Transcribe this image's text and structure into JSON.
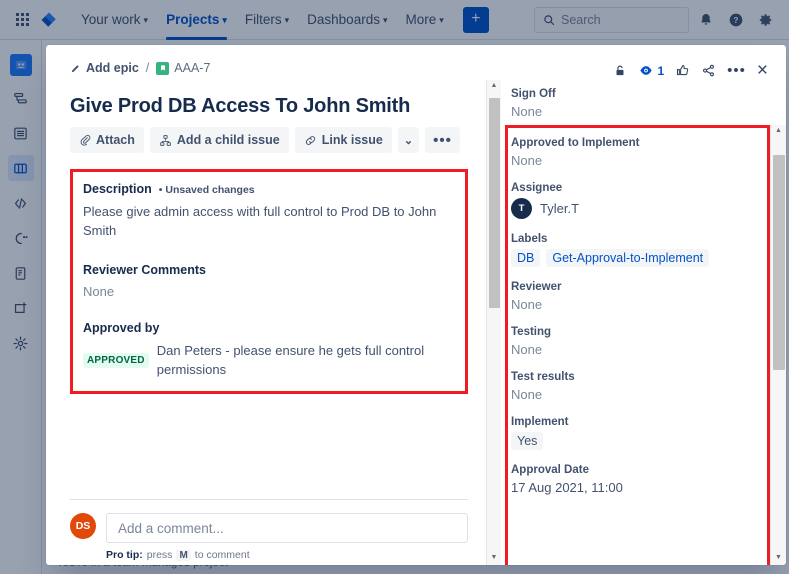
{
  "topnav": {
    "apps_icon": "app-switcher-icon",
    "logo": "jira-logo-icon",
    "items": [
      {
        "label": "Your work",
        "has_caret": true,
        "active": false
      },
      {
        "label": "Projects",
        "has_caret": true,
        "active": true
      },
      {
        "label": "Filters",
        "has_caret": true,
        "active": false
      },
      {
        "label": "Dashboards",
        "has_caret": true,
        "active": false
      },
      {
        "label": "More",
        "has_caret": true,
        "active": false
      }
    ],
    "create_label": "+",
    "search_placeholder": "Search",
    "icons": [
      "notifications-bell-icon",
      "help-icon",
      "settings-gear-icon"
    ],
    "accent": "#0052cc"
  },
  "sidebar": {
    "items": [
      {
        "name": "project-avatar",
        "icon": "project-avatar-icon",
        "active": false
      },
      {
        "name": "roadmap",
        "icon": "roadmap-icon",
        "active": false
      },
      {
        "name": "backlog",
        "icon": "backlog-icon",
        "active": false
      },
      {
        "name": "board",
        "icon": "board-icon",
        "active": true
      },
      {
        "name": "code",
        "icon": "code-icon",
        "active": false
      },
      {
        "name": "releases",
        "icon": "releases-icon",
        "active": false
      },
      {
        "name": "pages",
        "icon": "pages-icon",
        "active": false
      },
      {
        "name": "add-item",
        "icon": "add-shortcut-icon",
        "active": false
      },
      {
        "name": "project-settings",
        "icon": "settings-gear-icon",
        "active": false
      }
    ]
  },
  "statusbar": {
    "text": "You're in a team-managed project"
  },
  "modal": {
    "breadcrumb": {
      "add_epic": "Add epic",
      "separator": "/",
      "issue_key": "AAA-7",
      "issue_type_icon": "task-icon"
    },
    "header_actions": [
      {
        "name": "lock-icon",
        "label": ""
      },
      {
        "name": "watch-eye-icon",
        "label": "1"
      },
      {
        "name": "thumbs-up-icon",
        "label": ""
      },
      {
        "name": "share-icon",
        "label": ""
      },
      {
        "name": "more-actions-icon",
        "label": "•••"
      },
      {
        "name": "close-icon",
        "label": "×"
      }
    ],
    "title": "Give Prod DB Access To John Smith",
    "buttons": [
      {
        "name": "attach-button",
        "label": "Attach",
        "icon": "paperclip-icon"
      },
      {
        "name": "add-child-issue-button",
        "label": "Add a child issue",
        "icon": "child-issue-icon"
      },
      {
        "name": "link-issue-button",
        "label": "Link issue",
        "icon": "link-icon"
      },
      {
        "name": "more-options-chevron",
        "label": "⌄",
        "icon": "chevron-down-icon"
      },
      {
        "name": "more-actions-button",
        "label": "•••",
        "icon": "ellipsis-icon"
      }
    ],
    "description": {
      "label": "Description",
      "unsaved": "• Unsaved changes",
      "body": "Please give admin access with full control to Prod DB to John Smith"
    },
    "reviewer_comments": {
      "label": "Reviewer Comments",
      "value": "None"
    },
    "approved_by": {
      "label": "Approved by",
      "badge": "APPROVED",
      "text": "Dan Peters - please ensure he gets full control permissions",
      "badge_bg": "#e3fcef",
      "badge_color": "#006644"
    },
    "comment": {
      "avatar_initials": "DS",
      "placeholder": "Add a comment...",
      "protip_prefix": "Pro tip:",
      "protip_press": "press",
      "protip_key": "M",
      "protip_suffix": "to comment"
    },
    "fields": [
      {
        "label": "Sign Off",
        "value": "None",
        "type": "none"
      },
      {
        "label": "Approved to Implement",
        "value": "None",
        "type": "none"
      },
      {
        "label": "Assignee",
        "value": "Tyler.T",
        "type": "user",
        "avatar_initial": "T"
      },
      {
        "label": "Labels",
        "type": "labels",
        "values": [
          "DB",
          "Get-Approval-to-Implement"
        ]
      },
      {
        "label": "Reviewer",
        "value": "None",
        "type": "none"
      },
      {
        "label": "Testing",
        "value": "None",
        "type": "none"
      },
      {
        "label": "Test results",
        "value": "None",
        "type": "none"
      },
      {
        "label": "Implement",
        "value": "Yes",
        "type": "chip"
      },
      {
        "label": "Approval Date",
        "value": "17 Aug 2021, 11:00",
        "type": "text"
      }
    ]
  },
  "annotations": {
    "box_color": "#ee1c25",
    "description_box": "highlight-description-region",
    "fields_box": "highlight-fields-region"
  }
}
